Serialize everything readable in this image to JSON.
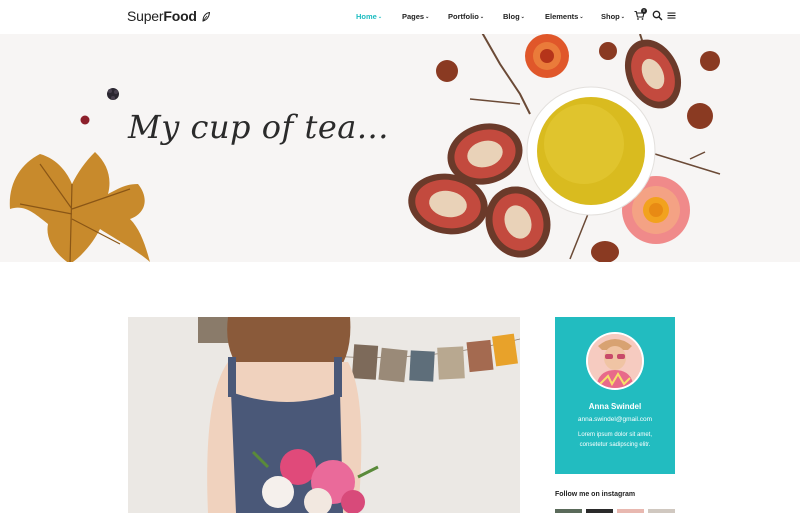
{
  "brand": {
    "name_regular": "Super",
    "name_bold": "Food"
  },
  "nav": {
    "items": [
      {
        "label": "Home",
        "active": true
      },
      {
        "label": "Pages",
        "active": false
      },
      {
        "label": "Portfolio",
        "active": false
      },
      {
        "label": "Blog",
        "active": false
      },
      {
        "label": "Elements",
        "active": false
      },
      {
        "label": "Shop",
        "active": false
      }
    ],
    "cart_count": "0",
    "icons": [
      "cart-icon",
      "search-icon",
      "menu-icon"
    ]
  },
  "hero": {
    "title": "My cup of tea..."
  },
  "author": {
    "name": "Anna Swindel",
    "email": "anna.swindel@gmail.com",
    "bio": "Lorem ipsum dolor sit amet, consetetur sadipscing elitr."
  },
  "instagram": {
    "title": "Follow me on instagram"
  },
  "colors": {
    "accent": "#22bcc0",
    "text": "#222222",
    "hero_bg": "#f7f5f4"
  }
}
